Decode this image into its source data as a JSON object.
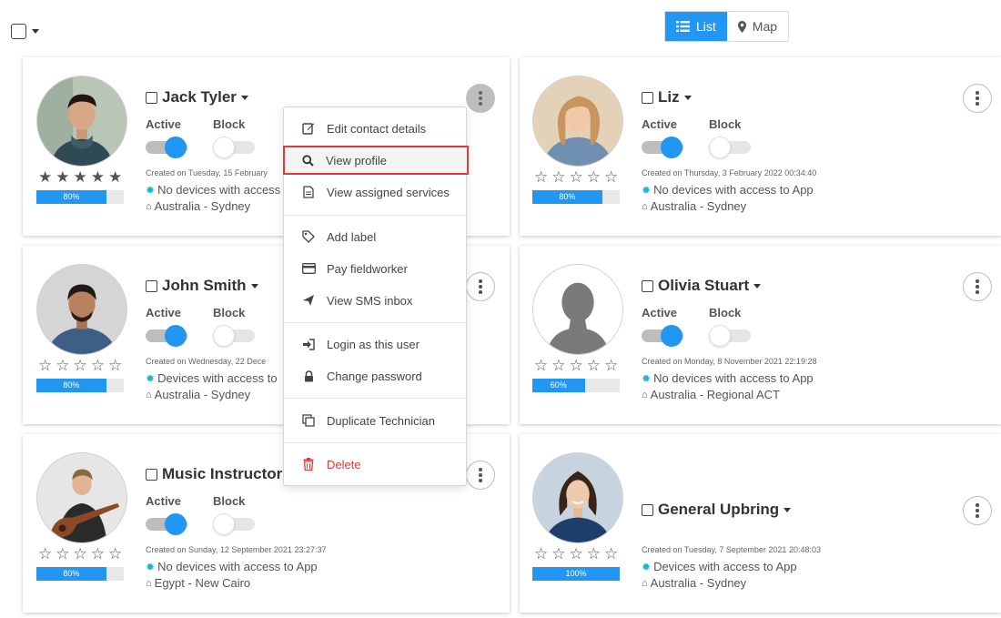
{
  "toolbar": {
    "list_label": "List",
    "map_label": "Map",
    "list_icon": "list-icon",
    "map_icon": "map-marker-icon"
  },
  "labels": {
    "active": "Active",
    "block": "Block"
  },
  "colors": {
    "accent": "#2196f3",
    "danger": "#e53935",
    "status_icon": "#1fb7c9"
  },
  "cards": [
    {
      "name": "Jack Tyler",
      "created": "Created on Tuesday, 15 February",
      "devices": "No devices with access",
      "location": "Australia - Sydney",
      "rating": 5,
      "progress": "80%",
      "active": true,
      "blocked": false
    },
    {
      "name": "Liz",
      "created": "Created on Thursday, 3 February 2022 00:34:40",
      "devices": "No devices with access to App",
      "location": "Australia - Sydney",
      "rating": 0,
      "progress": "80%",
      "active": true,
      "blocked": false
    },
    {
      "name": "John Smith",
      "created": "Created on Wednesday, 22 Dece",
      "devices": "Devices with access to",
      "location": "Australia - Sydney",
      "rating": 0,
      "progress": "80%",
      "active": true,
      "blocked": false
    },
    {
      "name": "Olivia Stuart",
      "created": "Created on Monday, 8 November 2021 22:19:28",
      "devices": "No devices with access to App",
      "location": "Australia - Regional ACT",
      "rating": 0,
      "progress": "60%",
      "active": true,
      "blocked": false
    },
    {
      "name": "Music Instructor",
      "created": "Created on Sunday, 12 September 2021 23:27:37",
      "devices": "No devices with access to App",
      "location": "Egypt - New Cairo",
      "rating": 0,
      "progress": "80%",
      "active": true,
      "blocked": false
    },
    {
      "name": "General Upbring",
      "created": "Created on Tuesday, 7 September 2021 20:48:03",
      "devices": "Devices with access to App",
      "location": "Australia - Sydney",
      "rating": 0,
      "progress": "100%",
      "active": false,
      "blocked": false
    }
  ],
  "menu": {
    "items": [
      {
        "label": "Edit contact details",
        "icon": "edit-icon"
      },
      {
        "label": "View profile",
        "icon": "search-icon"
      },
      {
        "label": "View assigned services",
        "icon": "document-icon"
      },
      {
        "label": "Add label",
        "icon": "tag-icon"
      },
      {
        "label": "Pay fieldworker",
        "icon": "credit-card-icon"
      },
      {
        "label": "View SMS inbox",
        "icon": "send-icon"
      },
      {
        "label": "Login as this user",
        "icon": "sign-in-icon"
      },
      {
        "label": "Change password",
        "icon": "lock-icon"
      },
      {
        "label": "Duplicate Technician",
        "icon": "copy-icon"
      },
      {
        "label": "Delete",
        "icon": "trash-icon"
      }
    ]
  }
}
